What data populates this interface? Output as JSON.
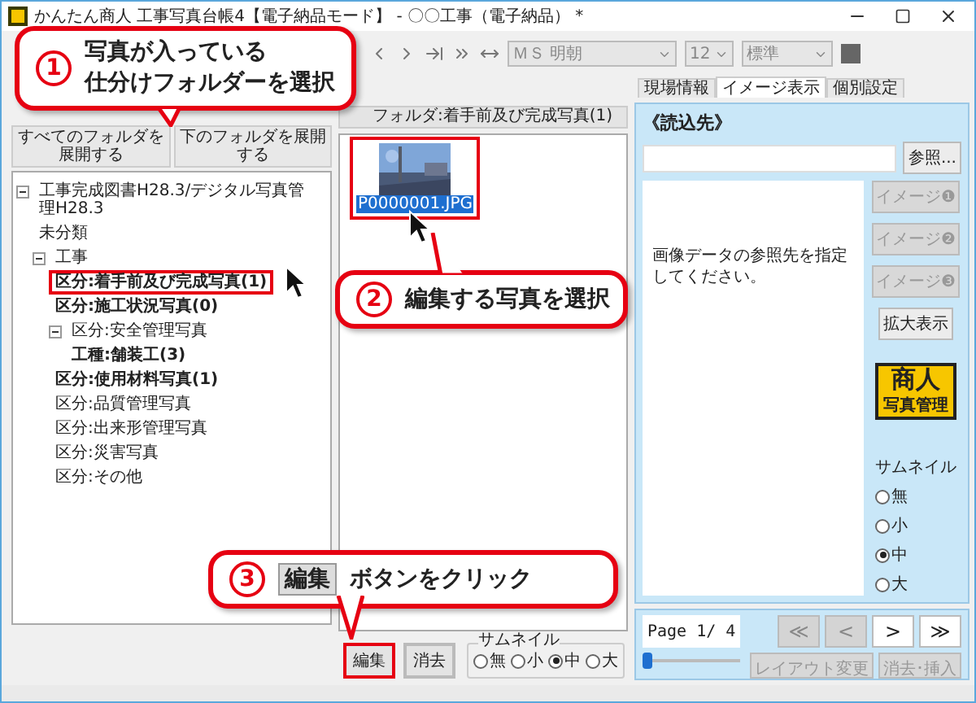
{
  "window": {
    "title": "かんたん商人 工事写真台帳4【電子納品モード】 - 〇〇工事（電子納品） *"
  },
  "toolbar": {
    "font": "ＭＳ 明朝",
    "size": "12",
    "style": "標準"
  },
  "folder_panel": {
    "buttons": [
      "すべてのフォルダを展開する",
      "下のフォルダを展開する"
    ],
    "tree": [
      {
        "label": "工事完成図書H28.3/デジタル写真管理H28.3",
        "bold": false,
        "selected": false,
        "expanded": true,
        "children": [
          {
            "label": "未分類",
            "bold": false,
            "selected": false
          },
          {
            "label": "工事",
            "bold": false,
            "selected": false,
            "expanded": true,
            "children": [
              {
                "label": "区分:着手前及び完成写真(1)",
                "bold": true,
                "selected": true
              },
              {
                "label": "区分:施工状況写真(0)",
                "bold": true,
                "selected": false
              },
              {
                "label": "区分:安全管理写真",
                "bold": false,
                "selected": false,
                "expanded": true,
                "children": [
                  {
                    "label": "工種:舗装工(3)",
                    "bold": true,
                    "selected": false
                  }
                ]
              },
              {
                "label": "区分:使用材料写真(1)",
                "bold": true,
                "selected": false
              },
              {
                "label": "区分:品質管理写真",
                "bold": false,
                "selected": false
              },
              {
                "label": "区分:出来形管理写真",
                "bold": false,
                "selected": false
              },
              {
                "label": "区分:災害写真",
                "bold": false,
                "selected": false
              },
              {
                "label": "区分:その他",
                "bold": false,
                "selected": false
              }
            ]
          }
        ]
      }
    ]
  },
  "photo_panel": {
    "header": "フォルダ:着手前及び完成写真(1)",
    "photos": [
      {
        "filename": "P0000001.JPG",
        "selected": true
      }
    ],
    "buttons": [
      {
        "label": "編集",
        "highlighted": true
      },
      {
        "label": "消去",
        "highlighted": false
      }
    ],
    "thumbnail_size": {
      "label": "サムネイル",
      "options": [
        {
          "label": "無",
          "selected": false
        },
        {
          "label": "小",
          "selected": false
        },
        {
          "label": "中",
          "selected": true
        },
        {
          "label": "大",
          "selected": false
        }
      ]
    }
  },
  "side_tabs": [
    {
      "label": "現場情報",
      "selected": false
    },
    {
      "label": "イメージ表示",
      "selected": true
    },
    {
      "label": "個別設定",
      "selected": false
    }
  ],
  "image_panel": {
    "heading": "《読込先》",
    "browse_button": "参照...",
    "message": "画像データの参照先を指定してください。",
    "image_buttons": [
      {
        "label": "イメージ❶",
        "disabled": true
      },
      {
        "label": "イメージ❷",
        "disabled": true
      },
      {
        "label": "イメージ❸",
        "disabled": true
      }
    ],
    "zoom_button": "拡大表示",
    "logo": {
      "title": "商人",
      "subtitle": "写真管理"
    },
    "thumbnail_size": {
      "label": "サムネイル",
      "options": [
        {
          "label": "無",
          "selected": false
        },
        {
          "label": "小",
          "selected": false
        },
        {
          "label": "中",
          "selected": true
        },
        {
          "label": "大",
          "selected": false
        }
      ]
    },
    "page": "Page 1/ 4",
    "nav_buttons": [
      {
        "label": "≪",
        "disabled": true
      },
      {
        "label": "<",
        "disabled": true
      },
      {
        "label": ">",
        "disabled": false
      },
      {
        "label": "≫",
        "disabled": false
      }
    ],
    "slider": {
      "level": 0
    },
    "buttons": [
      {
        "label": "レイアウト変更",
        "disabled": true
      },
      {
        "label": "消去･挿入",
        "disabled": true
      }
    ]
  },
  "callouts": [
    {
      "number": "1",
      "lines": [
        "写真が入っている",
        "仕分けフォルダーを選択"
      ]
    },
    {
      "number": "2",
      "lines": [
        "編集する写真を選択"
      ]
    },
    {
      "number": "3",
      "badge": "編集",
      "lines": [
        "ボタンをクリック"
      ]
    }
  ]
}
